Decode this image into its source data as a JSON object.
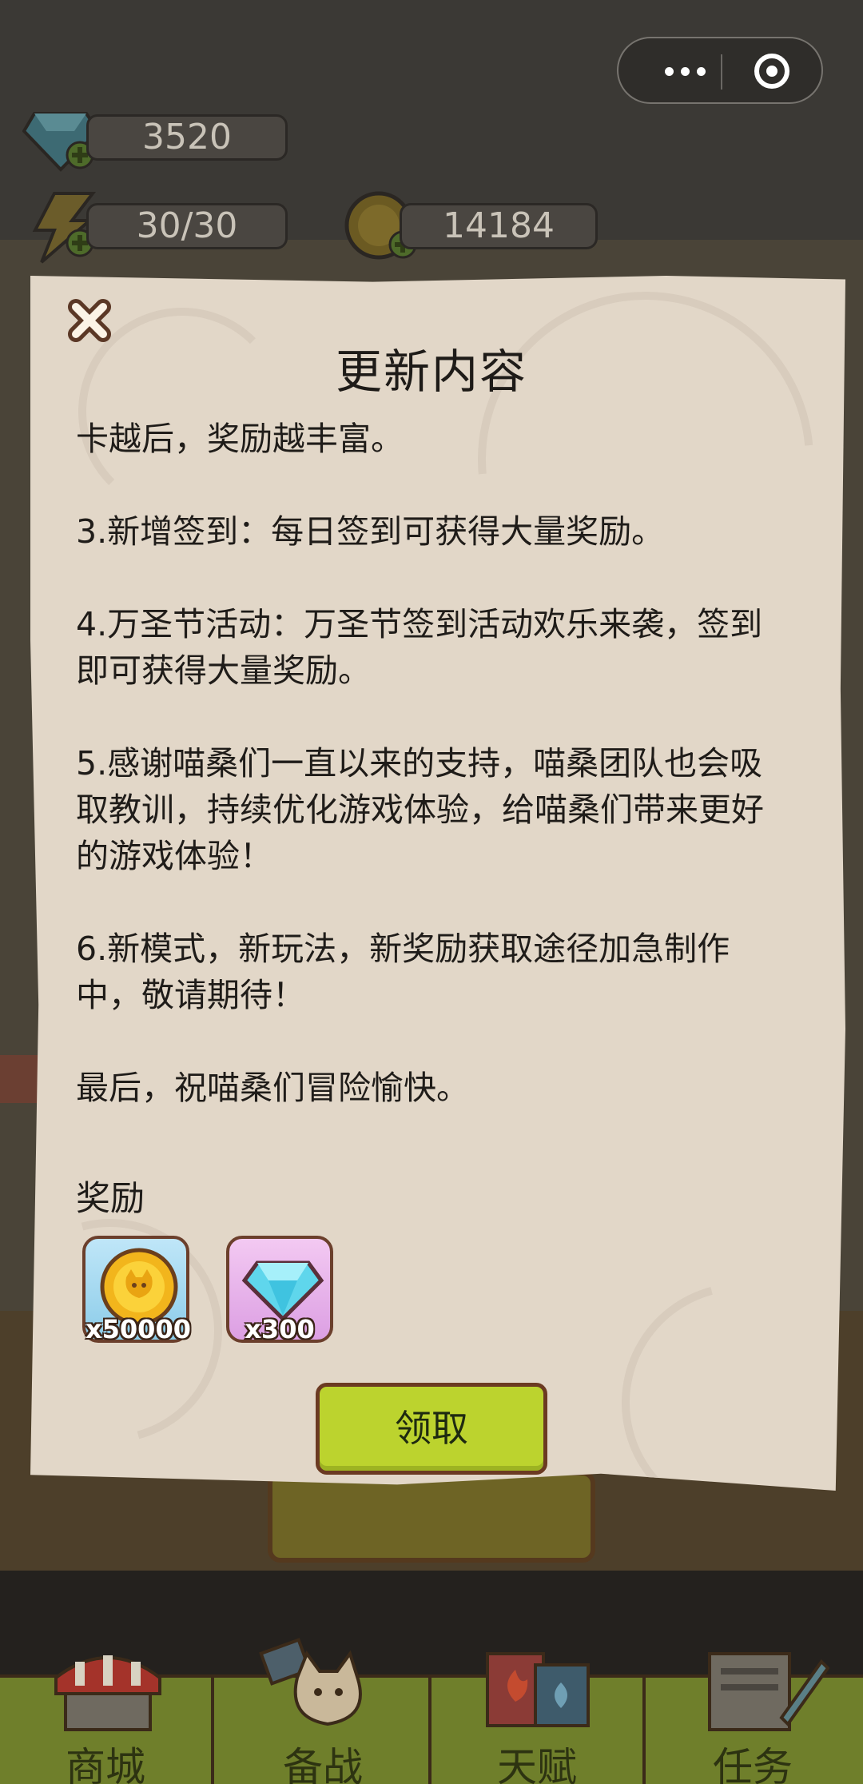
{
  "resources": {
    "gems": "3520",
    "energy": "30/30",
    "coins": "14184"
  },
  "capsule": {
    "more_icon": "more-dots-icon",
    "close_icon": "target-circle-icon"
  },
  "dialog": {
    "title": "更新内容",
    "paragraphs": [
      "卡越后，奖励越丰富。",
      "3.新增签到：每日签到可获得大量奖励。",
      "4.万圣节活动：万圣节签到活动欢乐来袭，签到即可获得大量奖励。",
      "5.感谢喵桑们一直以来的支持，喵桑团队也会吸取教训，持续优化游戏体验，给喵桑们带来更好的游戏体验！",
      "6.新模式，新玩法，新奖励获取途径加急制作中，敬请期待！",
      "最后，祝喵桑们冒险愉快。"
    ],
    "reward_label": "奖励",
    "rewards": [
      {
        "icon": "coin-icon",
        "count": "x50000"
      },
      {
        "icon": "diamond-icon",
        "count": "x300"
      }
    ],
    "claim_label": "领取"
  },
  "nav": {
    "items": [
      {
        "label": "商城",
        "icon": "shop-icon"
      },
      {
        "label": "备战",
        "icon": "cat-icon"
      },
      {
        "label": "天赋",
        "icon": "talent-book-icon"
      },
      {
        "label": "任务",
        "icon": "task-clipboard-icon"
      }
    ]
  },
  "colors": {
    "parchment": "#e2d7c8",
    "claim_button": "#bcd32e",
    "nav_bg": "#6f7f2b"
  }
}
